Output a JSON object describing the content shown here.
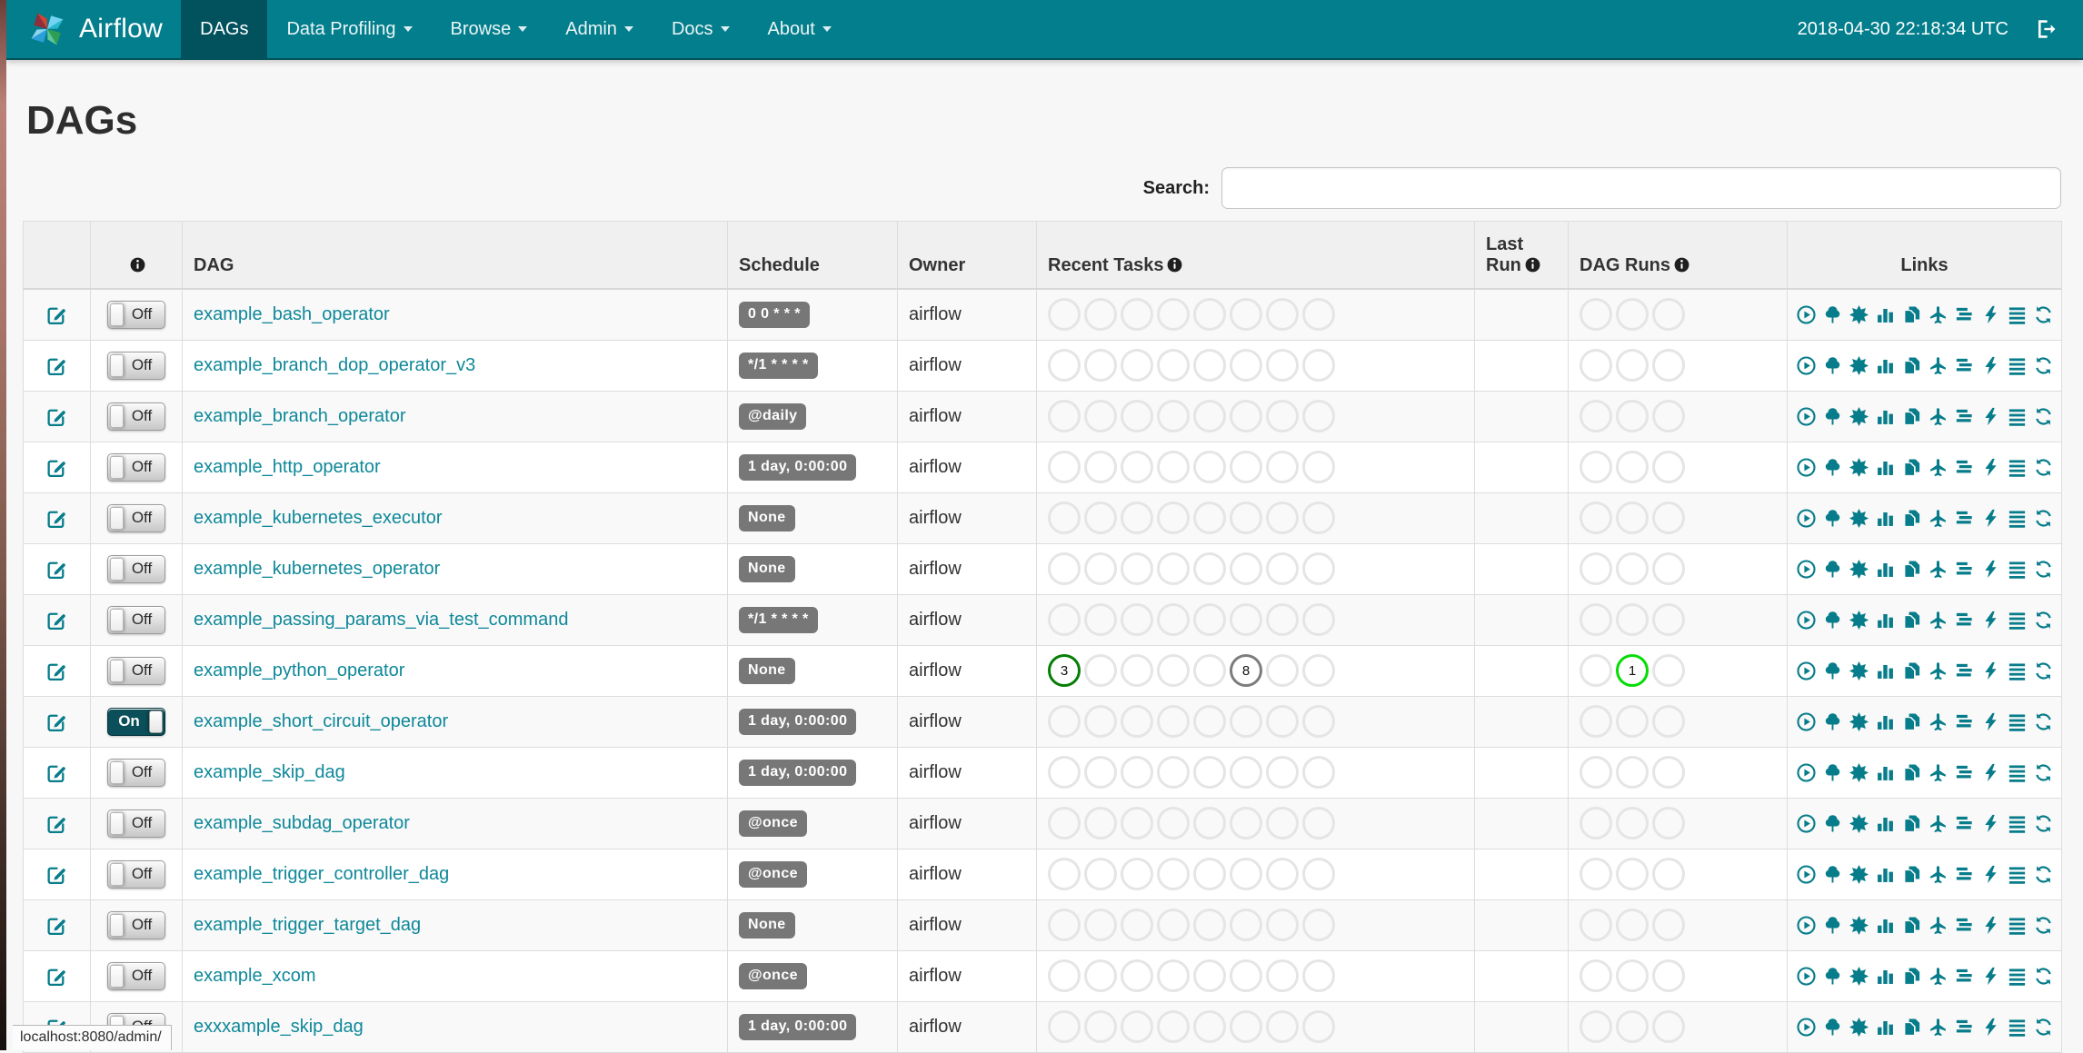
{
  "colors": {
    "accent": "#077C8A",
    "link": "#0E8899",
    "navbar": "#037E8C",
    "navbar_active": "#02525E",
    "badge_bg": "#777777"
  },
  "navbar": {
    "brand": "Airflow",
    "clock": "2018-04-30 22:18:34 UTC",
    "items": [
      {
        "label": "DAGs",
        "active": true,
        "caret": false
      },
      {
        "label": "Data Profiling",
        "active": false,
        "caret": true
      },
      {
        "label": "Browse",
        "active": false,
        "caret": true
      },
      {
        "label": "Admin",
        "active": false,
        "caret": true
      },
      {
        "label": "Docs",
        "active": false,
        "caret": true
      },
      {
        "label": "About",
        "active": false,
        "caret": true
      }
    ]
  },
  "page": {
    "title": "DAGs",
    "search_label": "Search:",
    "search_value": "",
    "status_bar": "localhost:8080/admin/"
  },
  "table": {
    "headers": {
      "dag": "DAG",
      "schedule": "Schedule",
      "owner": "Owner",
      "recent_tasks": "Recent Tasks",
      "last_run": "Last Run",
      "dag_runs": "DAG Runs",
      "links": "Links"
    },
    "recent_task_slots": 8,
    "dag_run_slots": 3,
    "links_icons": [
      {
        "name": "trigger-dag-icon",
        "symbol": "play-circle"
      },
      {
        "name": "tree-view-icon",
        "symbol": "tree"
      },
      {
        "name": "graph-view-icon",
        "symbol": "sunburst"
      },
      {
        "name": "task-duration-icon",
        "symbol": "bar-chart"
      },
      {
        "name": "task-tries-icon",
        "symbol": "copy"
      },
      {
        "name": "landing-times-icon",
        "symbol": "plane"
      },
      {
        "name": "gantt-view-icon",
        "symbol": "gantt"
      },
      {
        "name": "code-view-icon",
        "symbol": "bolt"
      },
      {
        "name": "logs-icon",
        "symbol": "list"
      },
      {
        "name": "refresh-dag-icon",
        "symbol": "refresh"
      }
    ],
    "rows": [
      {
        "name": "example_bash_operator",
        "toggle": "Off",
        "schedule": "0 0 * * *",
        "owner": "airflow",
        "task_counts": [],
        "run_counts": []
      },
      {
        "name": "example_branch_dop_operator_v3",
        "toggle": "Off",
        "schedule": "*/1 * * * *",
        "owner": "airflow",
        "task_counts": [],
        "run_counts": []
      },
      {
        "name": "example_branch_operator",
        "toggle": "Off",
        "schedule": "@daily",
        "owner": "airflow",
        "task_counts": [],
        "run_counts": []
      },
      {
        "name": "example_http_operator",
        "toggle": "Off",
        "schedule": "1 day, 0:00:00",
        "owner": "airflow",
        "task_counts": [],
        "run_counts": []
      },
      {
        "name": "example_kubernetes_executor",
        "toggle": "Off",
        "schedule": "None",
        "owner": "airflow",
        "task_counts": [],
        "run_counts": []
      },
      {
        "name": "example_kubernetes_operator",
        "toggle": "Off",
        "schedule": "None",
        "owner": "airflow",
        "task_counts": [],
        "run_counts": []
      },
      {
        "name": "example_passing_params_via_test_command",
        "toggle": "Off",
        "schedule": "*/1 * * * *",
        "owner": "airflow",
        "task_counts": [],
        "run_counts": []
      },
      {
        "name": "example_python_operator",
        "toggle": "Off",
        "schedule": "None",
        "owner": "airflow",
        "task_counts": [
          {
            "slot": 0,
            "count": "3",
            "color": "#067e06"
          },
          {
            "slot": 5,
            "count": "8",
            "color": "#7d7d7d"
          }
        ],
        "run_counts": [
          {
            "slot": 1,
            "count": "1",
            "color": "#04DD04"
          }
        ]
      },
      {
        "name": "example_short_circuit_operator",
        "toggle": "On",
        "schedule": "1 day, 0:00:00",
        "owner": "airflow",
        "task_counts": [],
        "run_counts": []
      },
      {
        "name": "example_skip_dag",
        "toggle": "Off",
        "schedule": "1 day, 0:00:00",
        "owner": "airflow",
        "task_counts": [],
        "run_counts": []
      },
      {
        "name": "example_subdag_operator",
        "toggle": "Off",
        "schedule": "@once",
        "owner": "airflow",
        "task_counts": [],
        "run_counts": []
      },
      {
        "name": "example_trigger_controller_dag",
        "toggle": "Off",
        "schedule": "@once",
        "owner": "airflow",
        "task_counts": [],
        "run_counts": []
      },
      {
        "name": "example_trigger_target_dag",
        "toggle": "Off",
        "schedule": "None",
        "owner": "airflow",
        "task_counts": [],
        "run_counts": []
      },
      {
        "name": "example_xcom",
        "toggle": "Off",
        "schedule": "@once",
        "owner": "airflow",
        "task_counts": [],
        "run_counts": []
      },
      {
        "name": "exxxample_skip_dag",
        "toggle": "Off",
        "schedule": "1 day, 0:00:00",
        "owner": "airflow",
        "task_counts": [],
        "run_counts": []
      }
    ]
  }
}
